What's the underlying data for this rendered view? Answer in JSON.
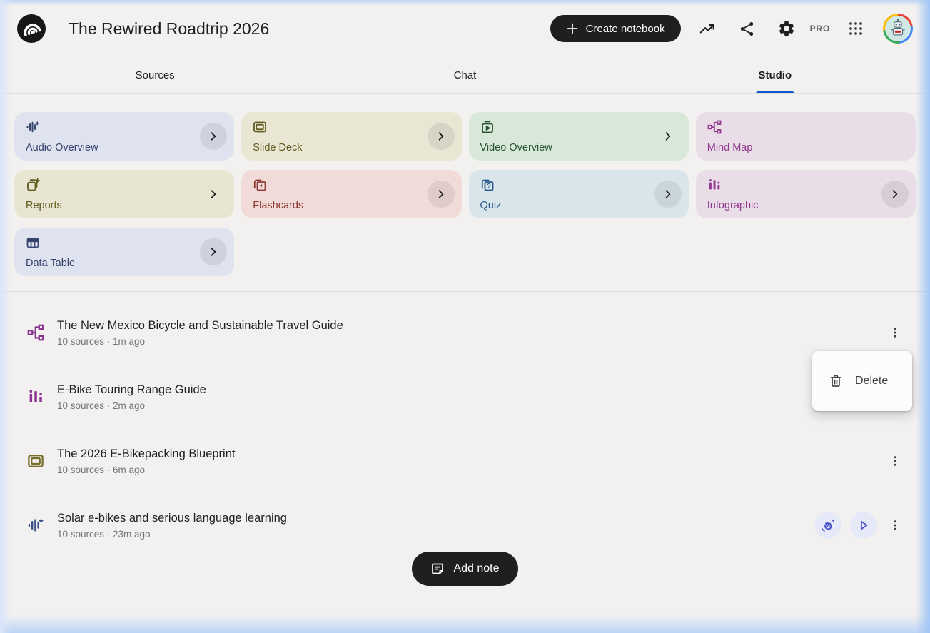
{
  "colors": {
    "accent": "#0b57d0",
    "dark_button": "#1f1f1f",
    "page_bg": "#f2f1ef"
  },
  "header": {
    "title": "The Rewired Roadtrip 2026",
    "create_label": "Create notebook",
    "pro_label": "PRO",
    "icons": [
      "notebooklm-logo",
      "plus-icon",
      "trending-up-icon",
      "share-icon",
      "settings-gear-icon",
      "apps-grid-icon",
      "avatar-robot"
    ]
  },
  "tabs": [
    {
      "label": "Sources"
    },
    {
      "label": "Chat"
    },
    {
      "label": "Studio",
      "active": true
    }
  ],
  "studio_cards": [
    {
      "label": "Audio Overview",
      "icon": "audio-waveform-sparkle-icon",
      "bg": "#dfe2ef",
      "fg": "#36456d"
    },
    {
      "label": "Slide Deck",
      "icon": "slide-deck-icon",
      "bg": "#e9e6d3",
      "fg": "#615a1e"
    },
    {
      "label": "Video Overview",
      "icon": "video-overview-icon",
      "bg": "#d7e8d8",
      "fg": "#2c5235"
    },
    {
      "label": "Mind Map",
      "icon": "mind-map-icon",
      "bg": "#e9dde7",
      "fg": "#91398f"
    },
    {
      "label": "Reports",
      "icon": "reports-icon",
      "bg": "#e8e5d2",
      "fg": "#615a1e"
    },
    {
      "label": "Flashcards",
      "icon": "flashcards-icon",
      "bg": "#f0dbd8",
      "fg": "#8f3a31"
    },
    {
      "label": "Quiz",
      "icon": "quiz-icon",
      "bg": "#d8e6eb",
      "fg": "#27588c"
    },
    {
      "label": "Infographic",
      "icon": "infographic-bars-icon",
      "bg": "#e9dde7",
      "fg": "#91398f"
    },
    {
      "label": "Data Table",
      "icon": "data-table-icon",
      "bg": "#dfe2ef",
      "fg": "#36456d"
    }
  ],
  "notes": [
    {
      "title": "The New Mexico Bicycle and Sustainable Travel Guide",
      "meta": "10 sources · 1m ago",
      "icon": "mind-map-icon",
      "icon_color": "#8a3391"
    },
    {
      "title": "E-Bike Touring Range Guide",
      "meta": "10 sources · 2m ago",
      "icon": "infographic-bars-icon",
      "icon_color": "#8a3391"
    },
    {
      "title": "The 2026 E-Bikepacking Blueprint",
      "meta": "10 sources · 6m ago",
      "icon": "slide-deck-icon",
      "icon_color": "#7a6e2e"
    },
    {
      "title": "Solar e-bikes and serious language learning",
      "meta": "10 sources · 23m ago",
      "icon": "audio-waveform-sparkle-icon",
      "icon_color": "#3b5086"
    }
  ],
  "context_menu": {
    "delete_label": "Delete",
    "icon": "trash-icon"
  },
  "footer": {
    "add_note_label": "Add note",
    "icon": "note-icon"
  }
}
